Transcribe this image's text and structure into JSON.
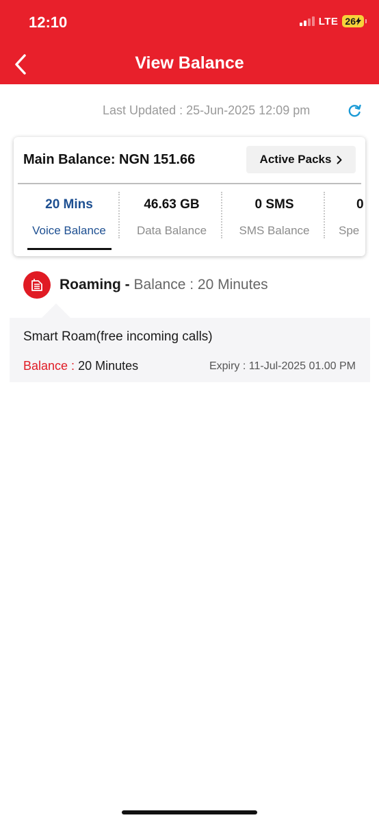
{
  "status_bar": {
    "time": "12:10",
    "network": "LTE",
    "battery": "26"
  },
  "header": {
    "title": "View Balance"
  },
  "last_updated": "Last Updated : 25-Jun-2025 12:09 pm",
  "card": {
    "main_balance": "Main Balance: NGN 151.66",
    "active_packs_label": "Active Packs",
    "tabs": [
      {
        "value": "20 Mins",
        "label": "Voice Balance"
      },
      {
        "value": "46.63 GB",
        "label": "Data Balance"
      },
      {
        "value": "0 SMS",
        "label": "SMS Balance"
      },
      {
        "value": "0",
        "label": "Spe"
      }
    ]
  },
  "roaming": {
    "title": "Roaming -",
    "summary": " Balance : 20 Minutes",
    "pack": {
      "name": "Smart Roam(free incoming calls)",
      "balance_label": "Balance :",
      "balance_value": " 20 Minutes",
      "expiry": "Expiry : 11-Jul-2025 01.00 PM"
    }
  },
  "colors": {
    "brand_red": "#e8202b",
    "active_blue": "#1d4f91",
    "refresh_blue": "#1a9ad6"
  },
  "icons": {
    "back": "chevron-left-icon",
    "refresh": "refresh-icon",
    "active_packs": "chevron-right-icon",
    "roaming": "sim-card-icon"
  }
}
